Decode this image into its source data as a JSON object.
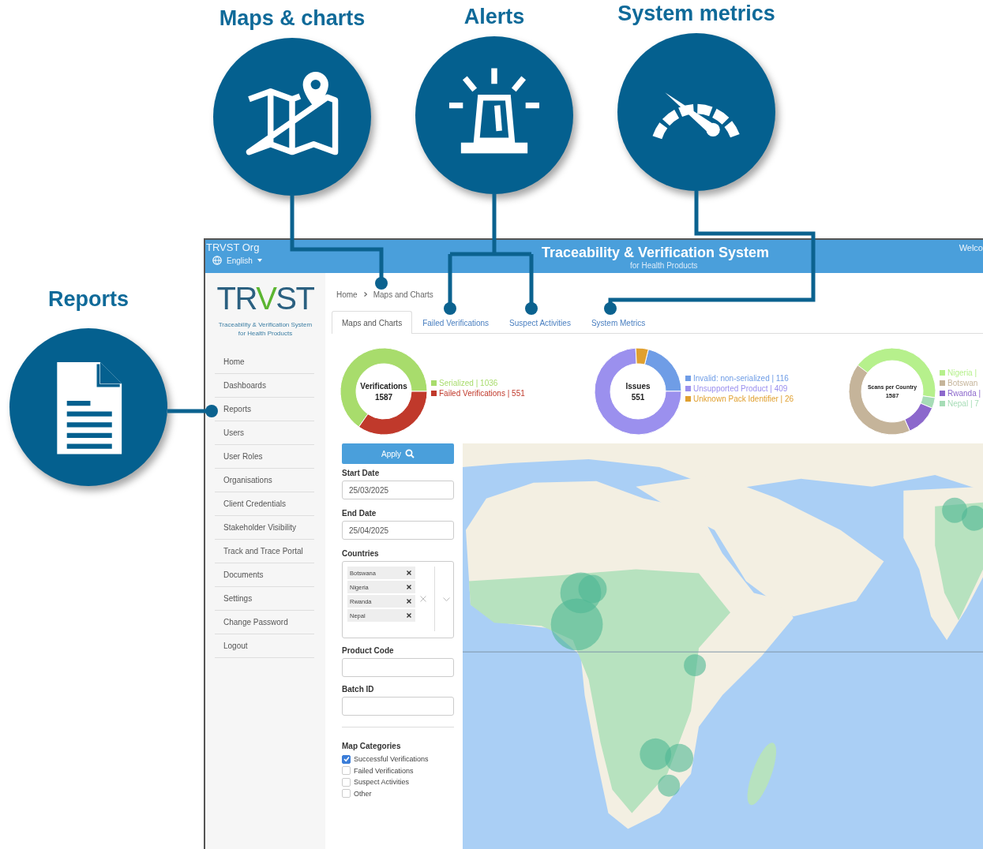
{
  "callouts": [
    {
      "title": "Maps & charts",
      "kind": "map"
    },
    {
      "title": "Alerts",
      "kind": "alert"
    },
    {
      "title": "System metrics",
      "kind": "gauge"
    },
    {
      "title": "Reports",
      "kind": "report"
    }
  ],
  "header": {
    "org": "TRVST Org",
    "language": "English",
    "title": "Traceability & Verification System",
    "subtitle": "for Health Products",
    "welcome": "Welco"
  },
  "logo": {
    "text": "TRVST",
    "tagline": [
      "Traceability & Verification System",
      "for Health Products"
    ]
  },
  "sidebar": {
    "items": [
      "Home",
      "Dashboards",
      "Reports",
      "Users",
      "User Roles",
      "Organisations",
      "Client Credentials",
      "Stakeholder Visibility",
      "Track and Trace Portal",
      "Documents",
      "Settings",
      "Change Password",
      "Logout"
    ]
  },
  "breadcrumb": [
    "Home",
    "Maps and Charts"
  ],
  "tabs": [
    {
      "label": "Maps and Charts",
      "selected": true
    },
    {
      "label": "Failed Verifications",
      "selected": false
    },
    {
      "label": "Suspect Activities",
      "selected": false
    },
    {
      "label": "System Metrics",
      "selected": false
    }
  ],
  "charts": [
    {
      "kind": "donut",
      "center_label": "1587",
      "legend": [
        {
          "color": "#a8dc6c"
        },
        {
          "color": "#c0392b"
        }
      ],
      "chart_data": {
        "type": "donut",
        "title": "Verifications",
        "categories": [
          "Serialized | 1036",
          "Failed Verifications | 551"
        ],
        "values": [
          1036,
          551
        ]
      }
    },
    {
      "kind": "donut",
      "center_label": "551",
      "legend": [
        {
          "color": "#6f9de6"
        },
        {
          "color": "#9b90ee"
        },
        {
          "color": "#e0a030"
        }
      ],
      "chart_data": {
        "type": "donut",
        "title": "Issues",
        "categories": [
          "Invalid: non-serialized | 116",
          "Unsupported Product | 409",
          "Unknown Pack Identifier | 26"
        ],
        "values": [
          116,
          409,
          26
        ]
      }
    },
    {
      "kind": "sketch",
      "title": "Scans per Country",
      "center_label": "1587",
      "legend": [
        {
          "label": "Nigeria |",
          "color": "#b6f08c"
        },
        {
          "label": "Botswan",
          "color": "#c5b49a"
        },
        {
          "label": "Rwanda |",
          "color": "#8c68cc"
        },
        {
          "label": "Nepal | 7",
          "color": "#a6dcb6"
        }
      ]
    }
  ],
  "filters": {
    "apply": "Apply",
    "start_date": {
      "label": "Start Date",
      "value": "25/03/2025"
    },
    "end_date": {
      "label": "End Date",
      "value": "25/04/2025"
    },
    "countries": {
      "label": "Countries",
      "tags": [
        "Botswana",
        "Nigeria",
        "Rwanda",
        "Nepal"
      ]
    },
    "product_code": {
      "label": "Product Code"
    },
    "batch_id": {
      "label": "Batch ID"
    },
    "map_categories": {
      "label": "Map Categories",
      "options": [
        {
          "label": "Successful Verifications",
          "checked": true
        },
        {
          "label": "Failed Verifications",
          "checked": false
        },
        {
          "label": "Suspect Activities",
          "checked": false
        },
        {
          "label": "Other",
          "checked": false
        }
      ]
    }
  },
  "map": {
    "kind": "picture"
  }
}
